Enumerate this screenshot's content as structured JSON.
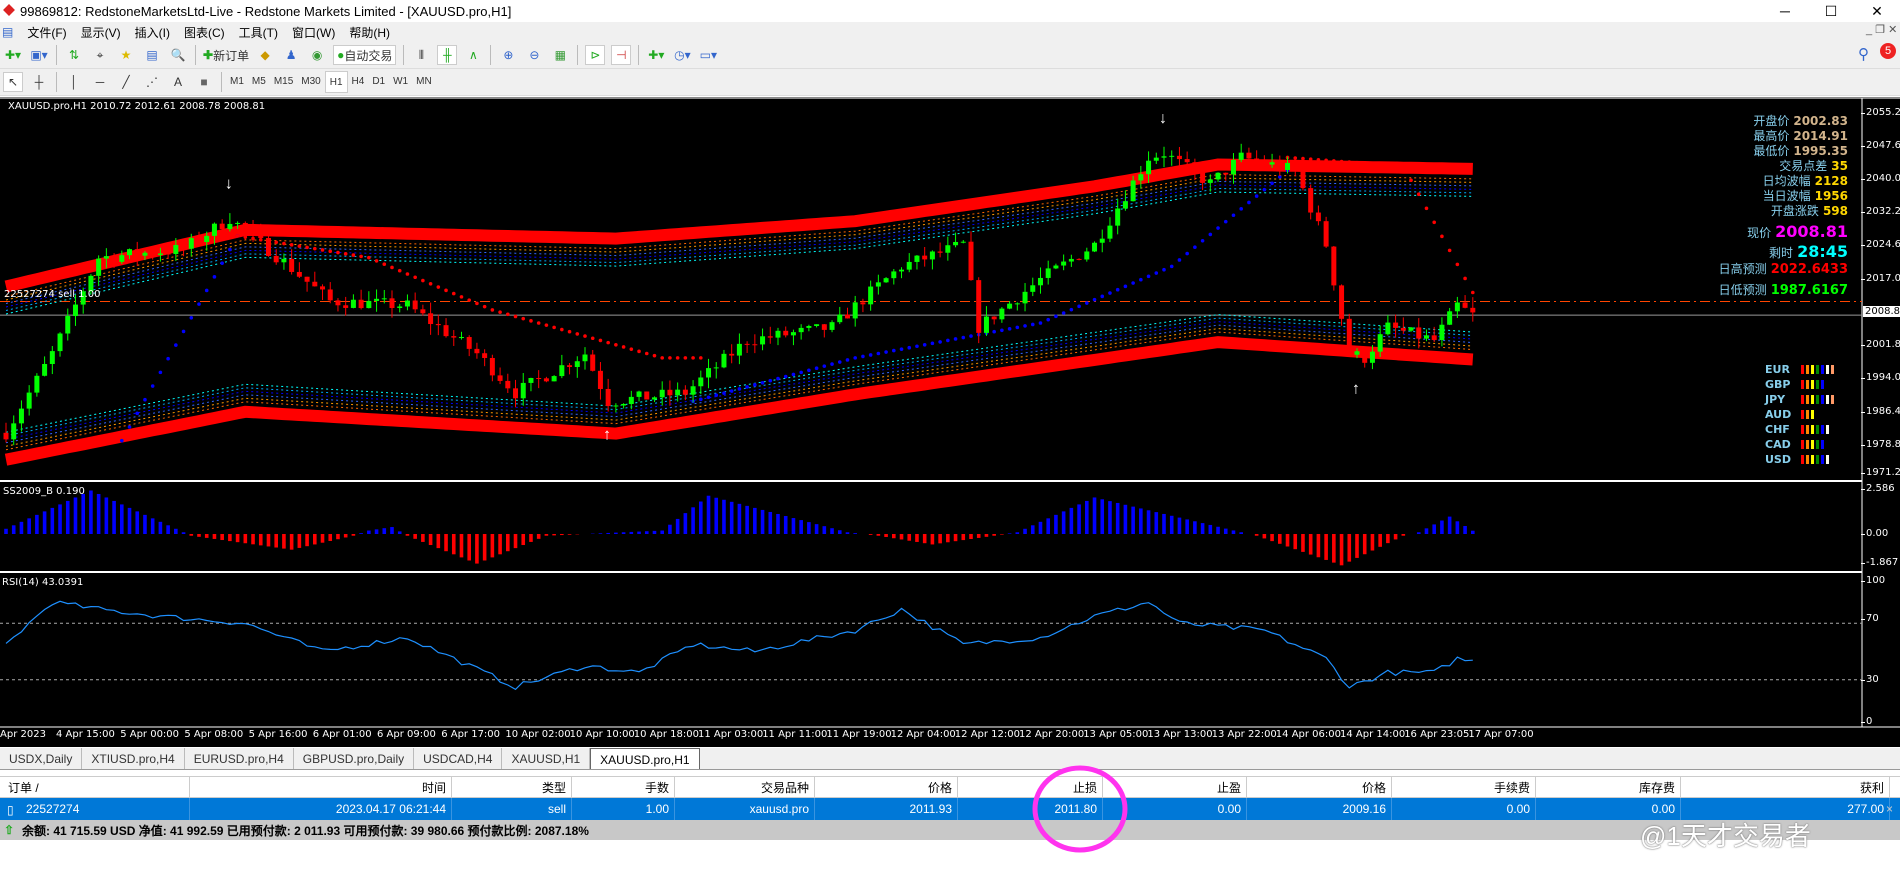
{
  "window": {
    "title": "99869812: RedstoneMarketsLtd-Live - Redstone Markets Limited - [XAUUSD.pro,H1]"
  },
  "menu": [
    "文件(F)",
    "显示(V)",
    "插入(I)",
    "图表(C)",
    "工具(T)",
    "窗口(W)",
    "帮助(H)"
  ],
  "toolbar": {
    "new_order": "新订单",
    "auto_trade": "自动交易",
    "notif_count": "5"
  },
  "timeframes": [
    "M1",
    "M5",
    "M15",
    "M30",
    "H1",
    "H4",
    "D1",
    "W1",
    "MN"
  ],
  "active_timeframe": "H1",
  "chart": {
    "header": "XAUUSD.pro,H1  2010.72 2012.61 2008.78 2008.81",
    "order_label": "22527274  sell 1.00",
    "price_axis": [
      "2055.20",
      "2047.60",
      "2040.00",
      "2032.20",
      "2024.60",
      "2017.00",
      "2001.80",
      "1994.00",
      "1986.40",
      "1978.80",
      "1971.20"
    ],
    "current_price": "2008.81",
    "order_price": 2011.93,
    "bars_count": 191,
    "price_path": [
      [
        0,
        1981.8
      ],
      [
        6,
        2000
      ],
      [
        12,
        2022
      ],
      [
        23,
        2024
      ],
      [
        29,
        2031
      ],
      [
        36,
        2021
      ],
      [
        42,
        2012
      ],
      [
        52,
        2011
      ],
      [
        61,
        2000
      ],
      [
        66,
        1991
      ],
      [
        75,
        2000
      ],
      [
        78,
        1989
      ],
      [
        88,
        1991
      ],
      [
        96,
        2003
      ],
      [
        107,
        2006
      ],
      [
        112,
        2014
      ],
      [
        116,
        2020
      ],
      [
        124,
        2025
      ],
      [
        126,
        2006
      ],
      [
        134,
        2017
      ],
      [
        141,
        2025
      ],
      [
        148,
        2045
      ],
      [
        150,
        2046
      ],
      [
        156,
        2039
      ],
      [
        160,
        2045
      ],
      [
        167,
        2042
      ],
      [
        171,
        2025
      ],
      [
        174,
        2000
      ],
      [
        176,
        1999
      ],
      [
        179,
        2006
      ],
      [
        185,
        2003
      ],
      [
        188,
        2011
      ],
      [
        190,
        2008.81
      ]
    ],
    "upper_band": [
      [
        0,
        2014
      ],
      [
        31,
        2027
      ],
      [
        79,
        2025
      ],
      [
        110,
        2029
      ],
      [
        141,
        2037
      ],
      [
        157,
        2042
      ],
      [
        190,
        2041
      ]
    ],
    "lower_band": [
      [
        0,
        1977
      ],
      [
        31,
        1988
      ],
      [
        79,
        1983
      ],
      [
        110,
        1992
      ],
      [
        157,
        2004
      ],
      [
        190,
        2000
      ]
    ],
    "blue_dots": [
      [
        15,
        1980
      ],
      [
        30,
        2027
      ],
      [],
      [
        89,
        1989
      ],
      [
        110,
        1999
      ],
      [
        134,
        2007
      ],
      [
        151,
        2020
      ],
      [
        166,
        2042
      ]
    ],
    "red_dots": [
      [
        30,
        2027
      ],
      [
        47,
        2022
      ],
      [
        63,
        2010
      ],
      [
        85,
        1999
      ],
      [
        90,
        1999
      ],
      [],
      [
        166,
        2045
      ],
      [
        181,
        2043
      ],
      [
        190,
        2014
      ]
    ],
    "down_arrows": [
      29,
      150
    ],
    "up_arrows": [
      78,
      175
    ],
    "osc": {
      "label": "SS2009_B 0.190",
      "axis": [
        "2.586",
        "0.00",
        "-1.867"
      ],
      "path": [
        [
          0,
          0.3
        ],
        [
          11,
          2.5
        ],
        [
          22,
          0.3
        ],
        [
          24,
          -0.1
        ],
        [
          37,
          -0.9
        ],
        [
          45,
          -0.1
        ],
        [
          47,
          0.2
        ],
        [
          50,
          0.4
        ],
        [
          52,
          -0.1
        ],
        [
          61,
          -1.7
        ],
        [
          70,
          -0.1
        ],
        [
          85,
          0.2
        ],
        [
          91,
          2.2
        ],
        [
          109,
          0.1
        ],
        [
          113,
          -0.1
        ],
        [
          120,
          -0.6
        ],
        [
          128,
          -0.1
        ],
        [
          131,
          0.1
        ],
        [
          141,
          2.1
        ],
        [
          160,
          0.1
        ],
        [
          162,
          -0.1
        ],
        [
          173,
          -1.8
        ],
        [
          181,
          -0.1
        ],
        [
          183,
          0.1
        ],
        [
          187,
          1.0
        ],
        [
          190,
          0.19
        ]
      ]
    },
    "rsi": {
      "label": "RSI(14) 43.0391",
      "axis": [
        "100",
        "70",
        "30",
        "0"
      ],
      "levels": [
        70,
        30
      ],
      "path": [
        [
          0,
          55
        ],
        [
          6,
          85
        ],
        [
          12,
          80
        ],
        [
          20,
          75
        ],
        [
          31,
          70
        ],
        [
          41,
          50
        ],
        [
          52,
          60
        ],
        [
          66,
          25
        ],
        [
          75,
          40
        ],
        [
          82,
          35
        ],
        [
          89,
          55
        ],
        [
          97,
          50
        ],
        [
          110,
          65
        ],
        [
          116,
          80
        ],
        [
          124,
          55
        ],
        [
          134,
          60
        ],
        [
          141,
          75
        ],
        [
          148,
          85
        ],
        [
          152,
          70
        ],
        [
          163,
          65
        ],
        [
          171,
          45
        ],
        [
          174,
          25
        ],
        [
          179,
          35
        ],
        [
          185,
          35
        ],
        [
          188,
          45
        ],
        [
          190,
          43
        ]
      ]
    },
    "time_labels": [
      "Apr 2023",
      "4 Apr 15:00",
      "5 Apr 00:00",
      "5 Apr 08:00",
      "5 Apr 16:00",
      "6 Apr 01:00",
      "6 Apr 09:00",
      "6 Apr 17:00",
      "10 Apr 02:00",
      "10 Apr 10:00",
      "10 Apr 18:00",
      "11 Apr 03:00",
      "11 Apr 11:00",
      "11 Apr 19:00",
      "12 Apr 04:00",
      "12 Apr 12:00",
      "12 Apr 20:00",
      "13 Apr 05:00",
      "13 Apr 13:00",
      "13 Apr 22:00",
      "14 Apr 06:00",
      "14 Apr 14:00",
      "16 Apr 23:05",
      "17 Apr 07:00"
    ]
  },
  "info_panel": [
    {
      "k": "开盘价",
      "v": "2002.83",
      "color": "#d2b48c"
    },
    {
      "k": "最高价",
      "v": "2014.91",
      "color": "#d2b48c"
    },
    {
      "k": "最低价",
      "v": "1995.35",
      "color": "#d2b48c"
    },
    {
      "k": "交易点差",
      "v": "35",
      "color": "#ffd700"
    },
    {
      "k": "日均波幅",
      "v": "2128",
      "color": "#ffd700"
    },
    {
      "k": "当日波幅",
      "v": "1956",
      "color": "#ffd700"
    },
    {
      "k": "开盘涨跌",
      "v": "598",
      "color": "#ffd700"
    },
    {
      "k": "现价",
      "v": "2008.81",
      "color": "#ff00ff"
    },
    {
      "k": "剩时",
      "v": "28:45",
      "color": "#00ffff"
    },
    {
      "k": "日高预测",
      "v": "2022.6433",
      "color": "#ff0000"
    },
    {
      "k": "日低预测",
      "v": "1987.6167",
      "color": "#00ff00"
    }
  ],
  "currencies": [
    {
      "name": "EUR",
      "bars": [
        "#f00",
        "#f80",
        "#ff0",
        "#080",
        "#00f",
        "#ffe",
        "#f96"
      ]
    },
    {
      "name": "GBP",
      "bars": [
        "#f00",
        "#f80",
        "#ff0",
        "#080",
        "#00f"
      ]
    },
    {
      "name": "JPY",
      "bars": [
        "#f00",
        "#f80",
        "#ff0",
        "#080",
        "#00f",
        "#ffe",
        "#f96"
      ]
    },
    {
      "name": "AUD",
      "bars": [
        "#f00",
        "#f80",
        "#ff0"
      ]
    },
    {
      "name": "CHF",
      "bars": [
        "#f00",
        "#f80",
        "#ff0",
        "#080",
        "#00f",
        "#ffe"
      ]
    },
    {
      "name": "CAD",
      "bars": [
        "#f00",
        "#f80",
        "#ff0",
        "#080",
        "#00f"
      ]
    },
    {
      "name": "USD",
      "bars": [
        "#f00",
        "#f80",
        "#ff0",
        "#080",
        "#00f",
        "#ffe"
      ]
    }
  ],
  "tabs": [
    "USDX,Daily",
    "XTIUSD.pro,H4",
    "EURUSD.pro,H4",
    "GBPUSD.pro,Daily",
    "USDCAD,H4",
    "XAUUSD,H1",
    "XAUUSD.pro,H1"
  ],
  "active_tab": "XAUUSD.pro,H1",
  "terminal": {
    "columns": [
      "订单  /",
      "时间",
      "类型",
      "手数",
      "交易品种",
      "价格",
      "止损",
      "止盈",
      "价格",
      "手续费",
      "库存费",
      "获利"
    ],
    "row": [
      "22527274",
      "2023.04.17 06:21:44",
      "sell",
      "1.00",
      "xauusd.pro",
      "2011.93",
      "2011.80",
      "0.00",
      "2009.16",
      "0.00",
      "0.00",
      "277.00"
    ],
    "balance": "余额: 41 715.59 USD  净值: 41 992.59  已用预付款: 2 011.93  可用预付款: 39 980.66  预付款比例: 2087.18%"
  },
  "watermark": "@1天才交易者",
  "colors": {
    "bull": "#00ff00",
    "bear": "#ff0000",
    "band": "#ff0000",
    "select": "#0078d7",
    "highlight": "#ff33ee"
  }
}
